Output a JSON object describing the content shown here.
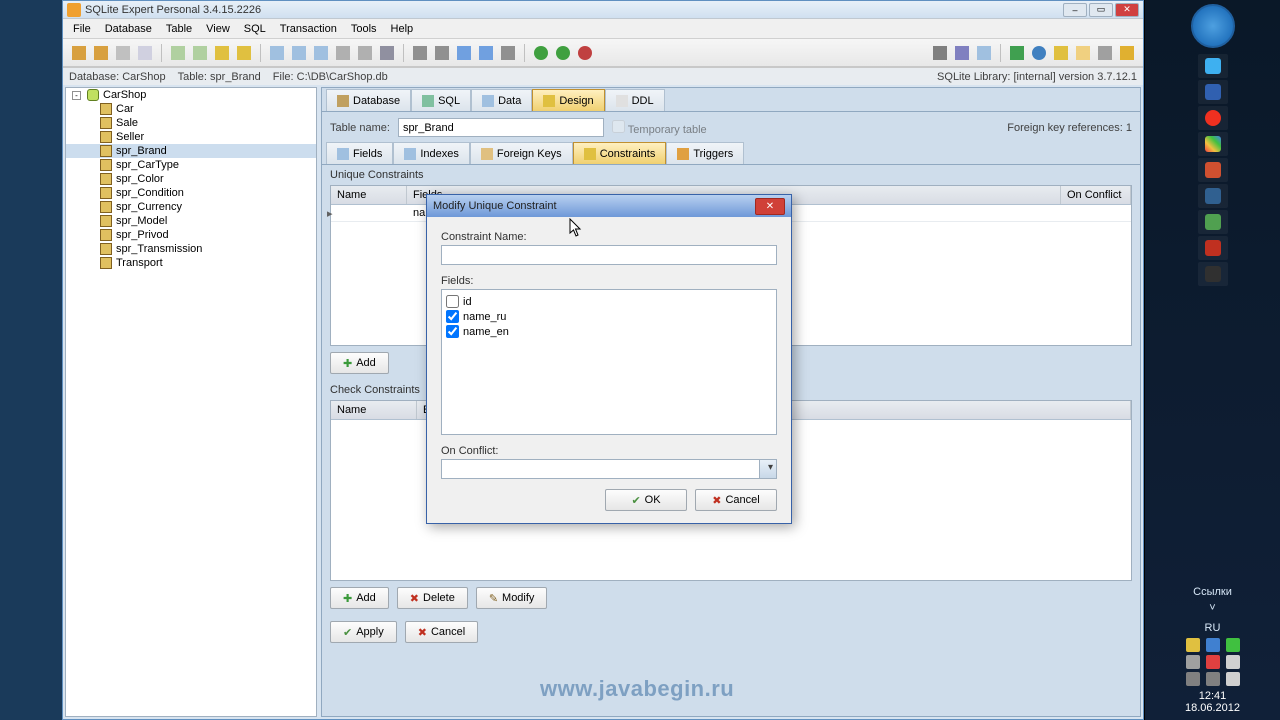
{
  "title": "SQLite Expert Personal 3.4.15.2226",
  "menus": [
    "File",
    "Database",
    "Table",
    "View",
    "SQL",
    "Transaction",
    "Tools",
    "Help"
  ],
  "status": {
    "db": "Database: CarShop",
    "table": "Table: spr_Brand",
    "file": "File: C:\\DB\\CarShop.db",
    "lib": "SQLite Library: [internal] version 3.7.12.1"
  },
  "tree": {
    "db": "CarShop",
    "nodes": [
      "Car",
      "Sale",
      "Seller",
      "spr_Brand",
      "spr_CarType",
      "spr_Color",
      "spr_Condition",
      "spr_Currency",
      "spr_Model",
      "spr_Privod",
      "spr_Transmission",
      "Transport"
    ],
    "selected": "spr_Brand"
  },
  "main_tabs": [
    "Database",
    "SQL",
    "Data",
    "Design",
    "DDL"
  ],
  "main_active": "Design",
  "table_label": "Table name:",
  "table_name": "spr_Brand",
  "temp_label": "Temporary table",
  "fk_label": "Foreign key references: 1",
  "design_tabs": [
    "Fields",
    "Indexes",
    "Foreign Keys",
    "Constraints",
    "Triggers"
  ],
  "design_active": "Constraints",
  "unique_label": "Unique Constraints",
  "check_label": "Check Constraints",
  "grid_cols_unique": {
    "name": "Name",
    "fields": "Fields",
    "conflict": "On Conflict"
  },
  "grid_cols_check": {
    "name": "Name",
    "expr": "E"
  },
  "grid_row0_fields": "na",
  "buttons": {
    "add": "Add",
    "delete": "Delete",
    "modify": "Modify",
    "apply": "Apply",
    "cancel": "Cancel"
  },
  "dialog": {
    "title": "Modify Unique Constraint",
    "name_label": "Constraint Name:",
    "name_value": "",
    "fields_label": "Fields:",
    "fields": [
      {
        "label": "id",
        "checked": false
      },
      {
        "label": "name_ru",
        "checked": true
      },
      {
        "label": "name_en",
        "checked": true
      }
    ],
    "conflict_label": "On Conflict:",
    "conflict_value": "",
    "ok": "OK",
    "cancel": "Cancel"
  },
  "taskbar": {
    "links_label": "Ссылки",
    "lang": "RU",
    "time": "12:41",
    "date": "18.06.2012"
  },
  "watermark": "www.javabegin.ru"
}
